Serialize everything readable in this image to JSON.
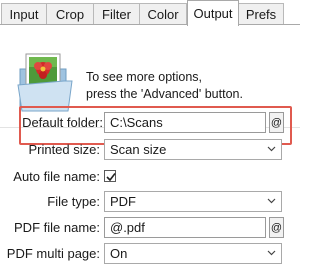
{
  "tabs": [
    {
      "label": "Input"
    },
    {
      "label": "Crop"
    },
    {
      "label": "Filter"
    },
    {
      "label": "Color"
    },
    {
      "label": "Output",
      "active": true
    },
    {
      "label": "Prefs"
    }
  ],
  "hint": {
    "line1": "To see more options,",
    "line2": "press the 'Advanced' button."
  },
  "form": {
    "default_folder": {
      "label": "Default folder:",
      "value": "C:\\Scans",
      "button": "@"
    },
    "printed_size": {
      "label": "Printed size:",
      "value": "Scan size"
    },
    "auto_file_name": {
      "label": "Auto file name:",
      "checked": true
    },
    "file_type": {
      "label": "File type:",
      "value": "PDF"
    },
    "pdf_file_name": {
      "label": "PDF file name:",
      "value": "@.pdf",
      "button": "@"
    },
    "pdf_multi_page": {
      "label": "PDF multi page:",
      "value": "On"
    }
  },
  "colors": {
    "highlight": "#e05a4f",
    "folder": "#b8d4ea",
    "flower": "#d42a2a"
  },
  "icons": [
    "folder-with-picture-icon",
    "chevron-down-icon",
    "checkmark-icon"
  ]
}
